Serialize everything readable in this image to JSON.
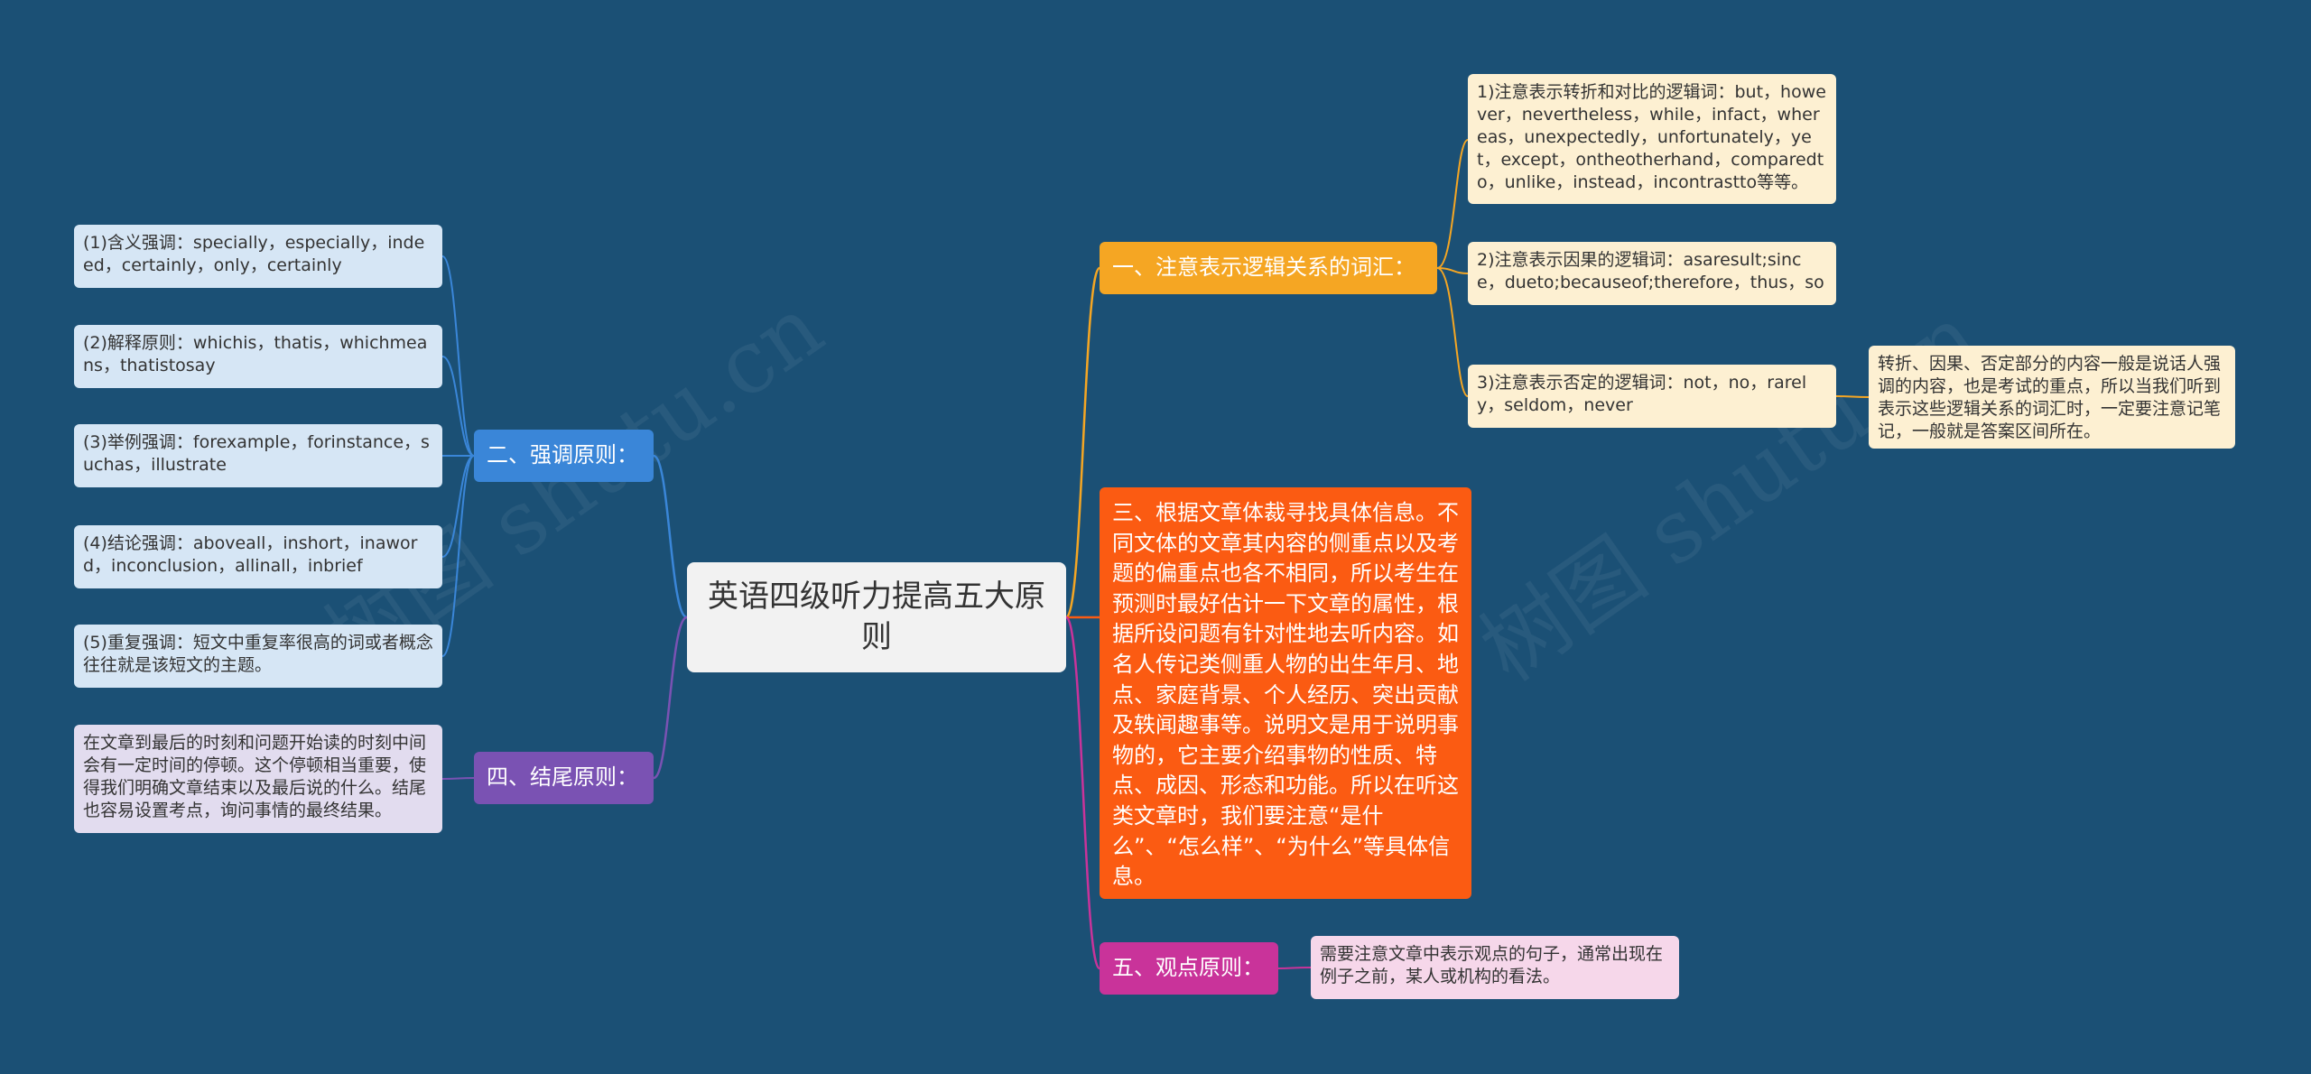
{
  "root": {
    "label": "英语四级听力提高五大原则"
  },
  "branches": {
    "logic": {
      "label": "一、注意表示逻辑关系的词汇：",
      "color": "#f5a623",
      "leaves": [
        "1)注意表示转折和对比的逻辑词：but，however，nevertheless，while，infact，whereas，unexpectedly，unfortunately，yet，except，ontheotherhand，comparedto，unlike，instead，incontrastto等等。",
        "2)注意表示因果的逻辑词：asaresult;since，dueto;becauseof;therefore，thus，so",
        "3)注意表示否定的逻辑词：not，no，rarely，seldom，never"
      ],
      "note": "转折、因果、否定部分的内容一般是说话人强调的内容，也是考试的重点，所以当我们听到表示这些逻辑关系的词汇时，一定要注意记笔记，一般就是答案区间所在。"
    },
    "emphasis": {
      "label": "二、强调原则：",
      "color": "#3a86d8",
      "leaves": [
        "(1)含义强调：specially，especially，indeed，certainly，only，certainly",
        "(2)解释原则：whichis，thatis，whichmeans，thatistosay",
        "(3)举例强调：forexample，forinstance，suchas，illustrate",
        "(4)结论强调：aboveall，inshort，inaword，inconclusion，allinall，inbrief",
        "(5)重复强调：短文中重复率很高的词或者概念往往就是该短文的主题。"
      ]
    },
    "genre": {
      "label": "三、根据文章体裁寻找具体信息。不同文体的文章其内容的侧重点以及考题的偏重点也各不相同，所以考生在预测时最好估计一下文章的属性，根据所设问题有针对性地去听内容。如名人传记类侧重人物的出生年月、地点、家庭背景、个人经历、突出贡献及轶闻趣事等。说明文是用于说明事物的，它主要介绍事物的性质、特点、成因、形态和功能。所以在听这类文章时，我们要注意“是什么”、“怎么样”、“为什么”等具体信息。",
      "color": "#fb5b12"
    },
    "ending": {
      "label": "四、结尾原则：",
      "color": "#7a52b3",
      "leaves": [
        "在文章到最后的时刻和问题开始读的时刻中间会有一定时间的停顿。这个停顿相当重要，使得我们明确文章结束以及最后说的什么。结尾也容易设置考点，询问事情的最终结果。"
      ]
    },
    "viewpoint": {
      "label": "五、观点原则：",
      "color": "#c9339a",
      "leaves": [
        "需要注意文章中表示观点的句子，通常出现在例子之前，某人或机构的看法。"
      ]
    }
  },
  "watermarks": [
    "树图 shutu.cn",
    "树图 shutu.cn"
  ]
}
